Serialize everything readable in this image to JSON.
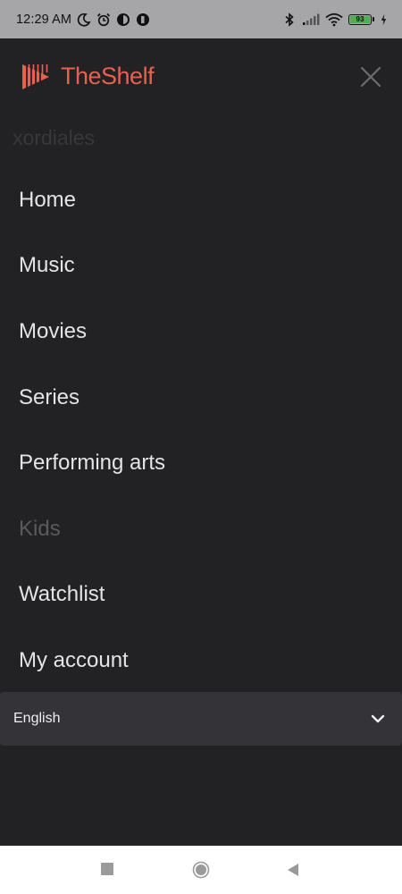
{
  "status_bar": {
    "time": "12:29 AM",
    "battery_level": "93",
    "icons": [
      "moon-icon",
      "alarm-icon",
      "app-icon",
      "app-icon",
      "bluetooth-icon",
      "signal-icon",
      "wifi-icon",
      "battery-icon",
      "charging-icon"
    ]
  },
  "header": {
    "brand_name": "TheShelf",
    "brand_color": "#e8614f",
    "close_icon": "close-icon"
  },
  "user": {
    "name": "xordiales"
  },
  "nav": {
    "items": [
      {
        "label": "Home"
      },
      {
        "label": "Music"
      },
      {
        "label": "Movies"
      },
      {
        "label": "Series"
      },
      {
        "label": "Performing arts"
      },
      {
        "label": "Kids"
      },
      {
        "label": "Watchlist"
      },
      {
        "label": "My account"
      }
    ]
  },
  "language": {
    "selected": "English",
    "icon": "chevron-down-icon"
  },
  "colors": {
    "background": "#222124",
    "status_bar": "#a6a6a8",
    "text": "#e4e4e6",
    "dim_text": "#5b5a5e",
    "select_bg": "#343337"
  }
}
